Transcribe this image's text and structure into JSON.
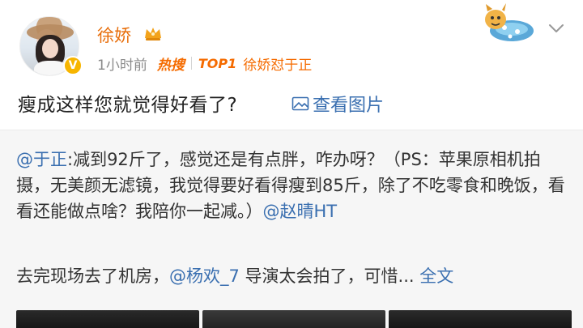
{
  "post": {
    "username": "徐娇",
    "time": "1小时前",
    "hot_badge": "热搜",
    "top_rank": "TOP1",
    "hot_topic": "徐娇怼于正",
    "text": "瘦成这样您就觉得好看了?",
    "view_images_label": "查看图片",
    "verified_mark": "V"
  },
  "repost": {
    "mention_author": "@于正",
    "text_part1": ":减到92斤了，感觉还是有点胖，咋办呀？（PS：苹果原相机拍摄，无美颜无滤镜，我觉得要好看得瘦到85斤，除了不吃零食和晚饭，看看还能做点啥？我陪你一起减。）",
    "mention_tag": "@赵晴HT",
    "line2_prefix": "去完现场去了机房，",
    "mention_line2": "@杨欢_7",
    "line2_suffix": " 导演太会拍了，可惜... ",
    "full_text_label": "全文"
  },
  "colors": {
    "username": "#e86e0a",
    "hot": "#f56b00",
    "link": "#3a6fb0",
    "repost_bg": "#f6f6f6"
  },
  "icons": [
    "crown-icon",
    "verified-badge-icon",
    "mascot-sticker",
    "chevron-down-icon",
    "image-icon"
  ]
}
